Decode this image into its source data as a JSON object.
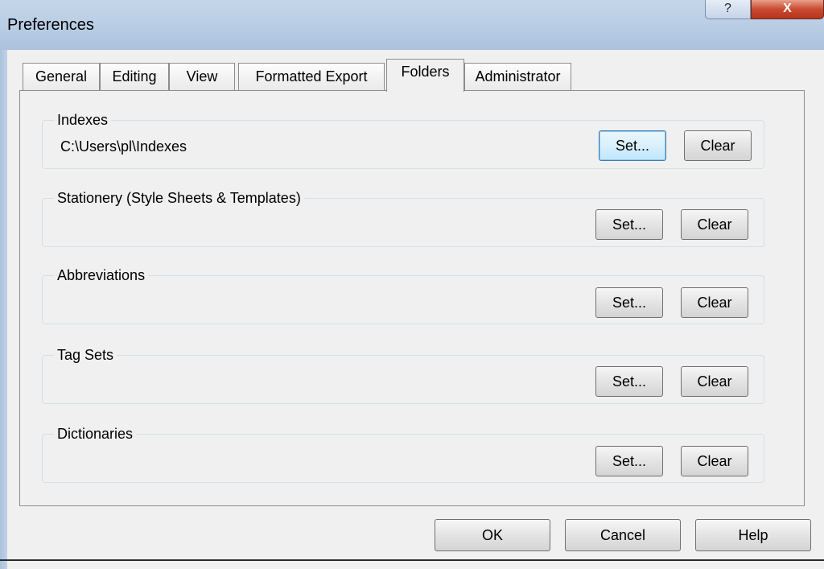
{
  "window": {
    "title": "Preferences",
    "help_glyph": "?",
    "close_glyph": "X"
  },
  "tabs": [
    {
      "label": "General",
      "active": false
    },
    {
      "label": "Editing",
      "active": false
    },
    {
      "label": "View",
      "active": false
    },
    {
      "label": "Formatted Export",
      "active": false
    },
    {
      "label": "Folders",
      "active": true
    },
    {
      "label": "Administrator",
      "active": false
    }
  ],
  "groups": [
    {
      "label": "Indexes",
      "path": "C:\\Users\\pl\\Indexes",
      "set_label": "Set...",
      "clear_label": "Clear"
    },
    {
      "label": "Stationery (Style Sheets & Templates)",
      "path": "",
      "set_label": "Set...",
      "clear_label": "Clear"
    },
    {
      "label": "Abbreviations",
      "path": "",
      "set_label": "Set...",
      "clear_label": "Clear"
    },
    {
      "label": "Tag Sets",
      "path": "",
      "set_label": "Set...",
      "clear_label": "Clear"
    },
    {
      "label": "Dictionaries",
      "path": "",
      "set_label": "Set...",
      "clear_label": "Clear"
    }
  ],
  "footer": {
    "ok_label": "OK",
    "cancel_label": "Cancel",
    "help_label": "Help"
  },
  "colors": {
    "titlebar": "#b8cde4",
    "close_button": "#c84a31",
    "focus_border": "#3c7fb1"
  }
}
